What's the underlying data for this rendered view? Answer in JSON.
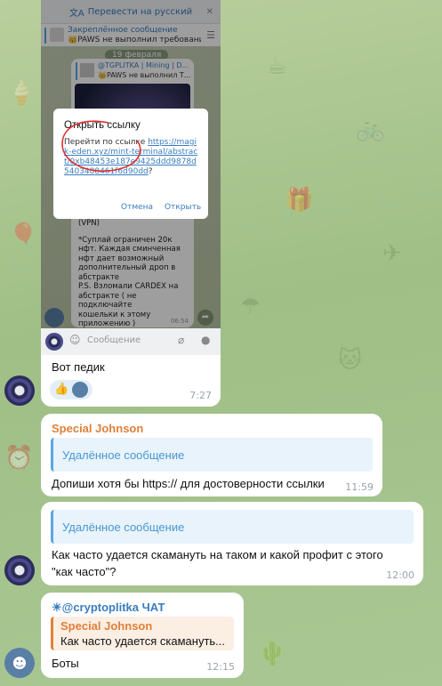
{
  "background_doodles": [
    "☕",
    "🚲",
    "🎁",
    "✈",
    "☂",
    "🐱",
    "🍦",
    "🎈",
    "⏰",
    "🌵"
  ],
  "msg1": {
    "screenshot": {
      "translate_bar": "Перевести на русский",
      "pinned_title": "Закреплённое сообщение",
      "pinned_text": "👑PAWS не выполнил требования Tel...",
      "date_badge": "19 февраля",
      "forward_title": "@TGPLITKA | Mining | D...",
      "forward_text": "👑PAWS не выполнил Т...",
      "post_lines": [
        "(VPN)",
        "",
        "*Суплай ограничен 20к",
        "нфт. Каждая сминченная",
        "нфт дает возможный",
        "дополнительный дроп в",
        "абстракте",
        "P.S. Взломали CARDEX на",
        "абстракте ( не подключайте",
        "кошельки к этому",
        "приложению )"
      ],
      "post_time": "06:54",
      "dialog_title": "Открыть ссылку",
      "dialog_prefix": "Перейти по ссылке ",
      "dialog_link": "https://magik-eden.xyz/mint-terminal/abstract/0xb48453e187e9425ddd9878d5403488461f6d90dd",
      "dialog_suffix": "?",
      "dialog_cancel": "Отмена",
      "dialog_open": "Открыть",
      "input_placeholder": "Сообщение"
    },
    "caption": "Вот педик",
    "reactions": [
      "👍"
    ],
    "time": "7:27"
  },
  "msg2": {
    "sender": "Special Johnson",
    "quote": "Удалённое сообщение",
    "text": "Допиши хотя бы https:// для достоверности ссылки",
    "time": "11:59"
  },
  "msg3": {
    "quote": "Удалённое сообщение",
    "text_line1": "Как часто удается скамануть на таком и какой профит с этого",
    "text_line2": "\"как часто\"?",
    "time": "12:00"
  },
  "msg4": {
    "sender": "☀@cryptoplitka ЧАТ",
    "quote_sender": "Special Johnson",
    "quote_text": "Как часто удается скамануть...",
    "text": "Боты",
    "time": "12:15"
  },
  "colors": {
    "accent": "#5aa7e0",
    "sender": "#e0803a",
    "bubble": "#ffffff"
  }
}
